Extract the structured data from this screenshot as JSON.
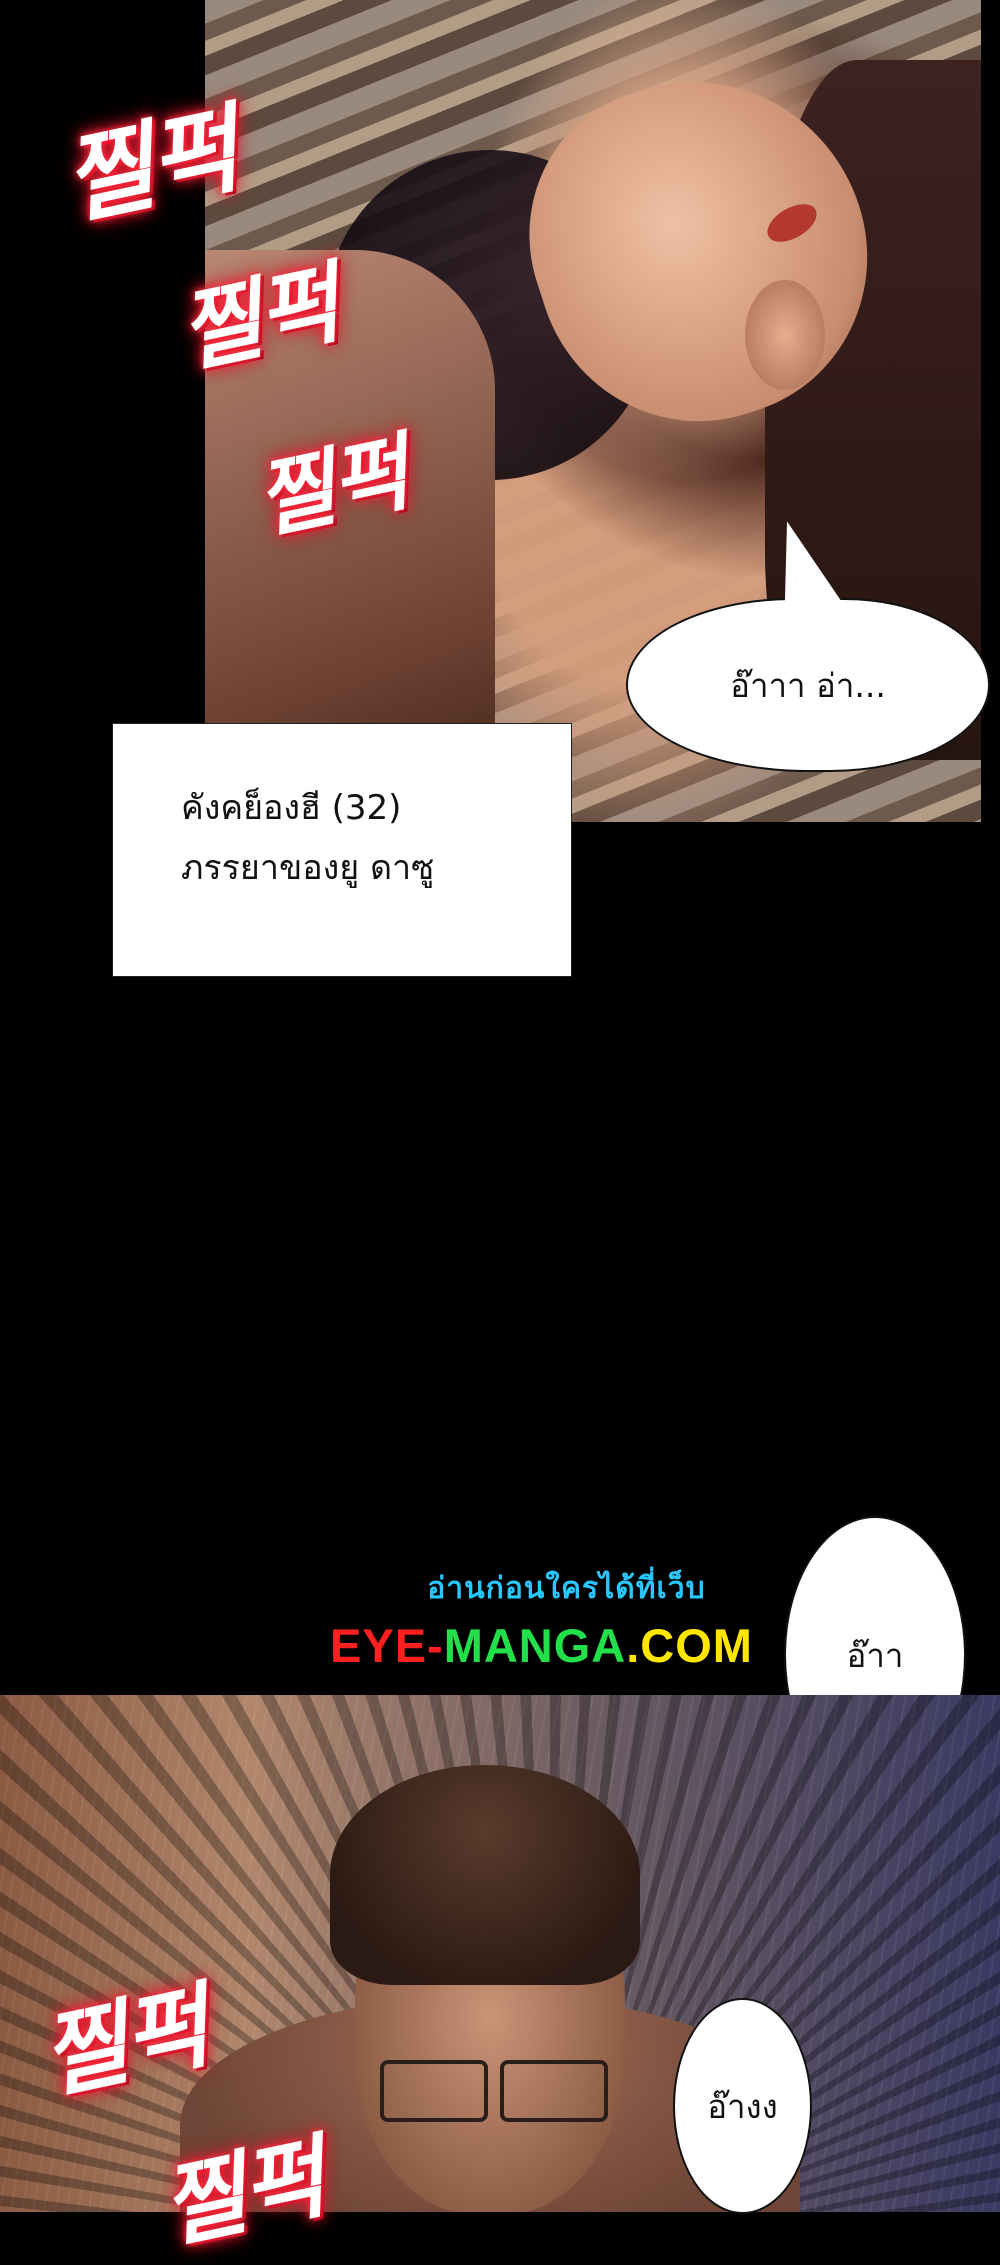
{
  "sound_effects": {
    "top": [
      "찔퍽",
      "찔퍽",
      "찔퍽"
    ],
    "bottom": [
      "찔퍽",
      "찔퍽"
    ]
  },
  "speech": {
    "moan_top": "อ๊าาา อ่า...",
    "moan_mid": "อ๊าา",
    "moan_bottom": "อ๊างง"
  },
  "caption": {
    "line1": "คังคย็องฮี (32)",
    "line2": "ภรรยาของยู ดาซู"
  },
  "promo": {
    "tagline": "อ่านก่อนใครได้ที่เว็บ",
    "site_eye": "EYE",
    "site_dash": "-",
    "site_manga": "MANGA",
    "site_dot_com": ".COM",
    "colors": {
      "tagline": "#28c8ff",
      "eye": "#ff2020",
      "manga": "#22e04a",
      "com": "#ffe600"
    }
  },
  "colors": {
    "background": "#000000",
    "sfx_glow": "#ff2b3e"
  }
}
